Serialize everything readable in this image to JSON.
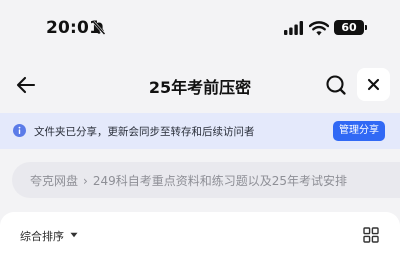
{
  "status_bar": {
    "time": "20:01",
    "battery": "60",
    "icons": [
      "bell-muted-icon",
      "signal-icon",
      "wifi-icon",
      "battery-icon"
    ]
  },
  "nav": {
    "title": "25年考前压密",
    "back_icon": "arrow-left-icon",
    "search_icon": "search-icon",
    "close_icon": "close-icon"
  },
  "banner": {
    "message": "文件夹已分享，更新会同步至转存和后续访问者",
    "button": "管理分享",
    "icon": "info-icon",
    "accent": "#3169f5",
    "background": "#e4e9fb"
  },
  "breadcrumb": {
    "root": "夸克网盘",
    "separator": "›",
    "current": "249科自考重点资料和练习题以及25年考试安排"
  },
  "toolbar": {
    "sort_label": "综合排序",
    "caret_icon": "caret-down-icon",
    "view_icon": "grid-view-icon"
  }
}
